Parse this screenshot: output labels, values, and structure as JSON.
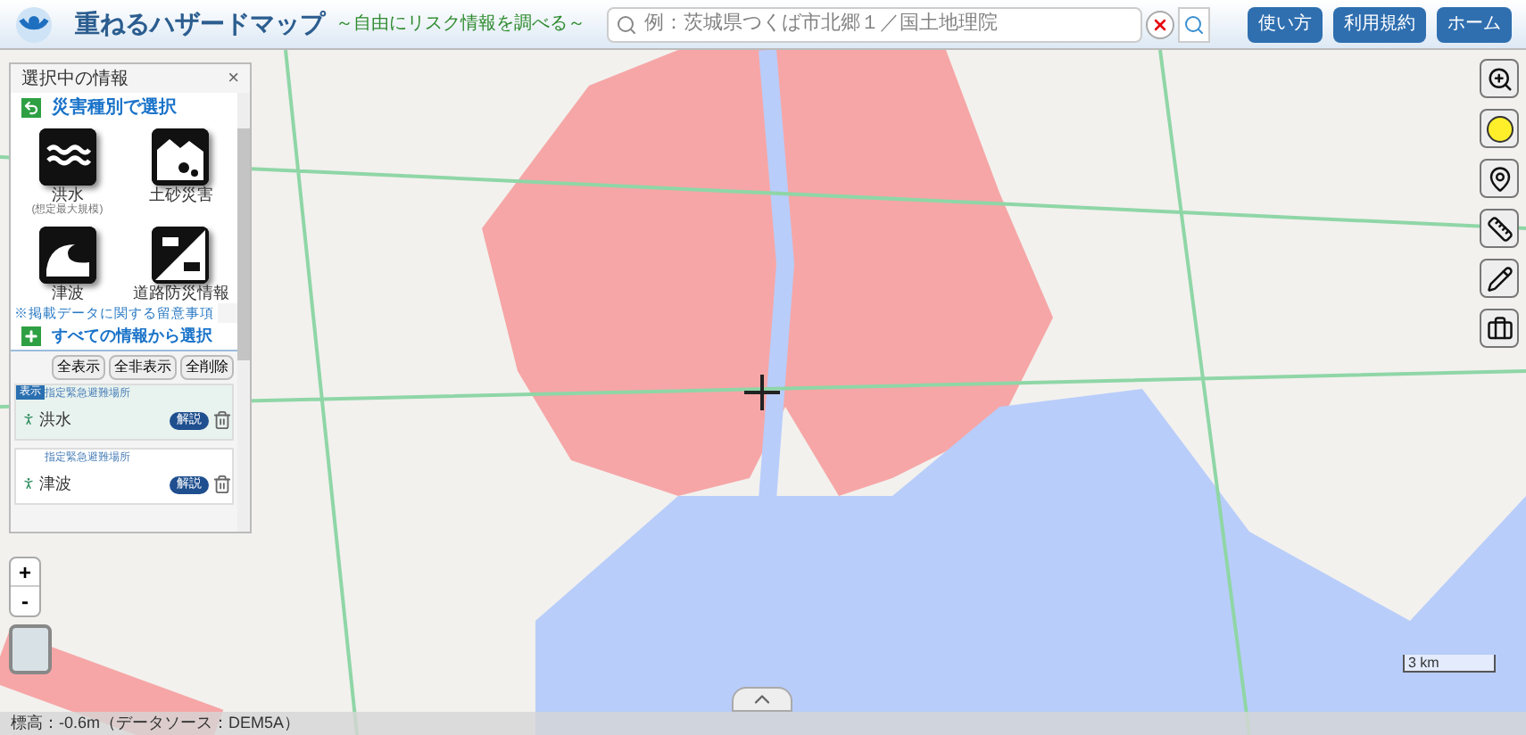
{
  "header": {
    "title": "重ねるハザードマップ",
    "subtitle": "～自由にリスク情報を調べる～",
    "search": {
      "placeholder": "例：茨城県つくば市北郷１／国土地理院"
    },
    "buttons": [
      "使い方",
      "利用規約",
      "ホーム"
    ]
  },
  "panel": {
    "title": "選択中の情報",
    "close": "×",
    "hazard_section": "災害種別で選択",
    "hazards": [
      {
        "kind": "flood",
        "label": "洪水",
        "note": "(想定最大規模)"
      },
      {
        "kind": "landslide",
        "label": "土砂災害"
      },
      {
        "kind": "tsunami",
        "label": "津波"
      },
      {
        "kind": "road",
        "label": "道路防災情報"
      }
    ],
    "notice_link": "※掲載データに関する留意事項",
    "all_section": "すべての情報から選択",
    "actions": [
      "全表示",
      "全非表示",
      "全削除"
    ],
    "layers": [
      {
        "shown": true,
        "badge": "表示",
        "category": "指定緊急避難場所",
        "name": "洪水",
        "info": "解説"
      },
      {
        "shown": false,
        "category": "指定緊急避難場所",
        "name": "津波",
        "info": "解説"
      }
    ]
  },
  "map": {
    "zoom_in": "+",
    "zoom_out": "-",
    "scale": "3 km",
    "elevation": "標高：-0.6m（データソース：DEM5A）"
  }
}
